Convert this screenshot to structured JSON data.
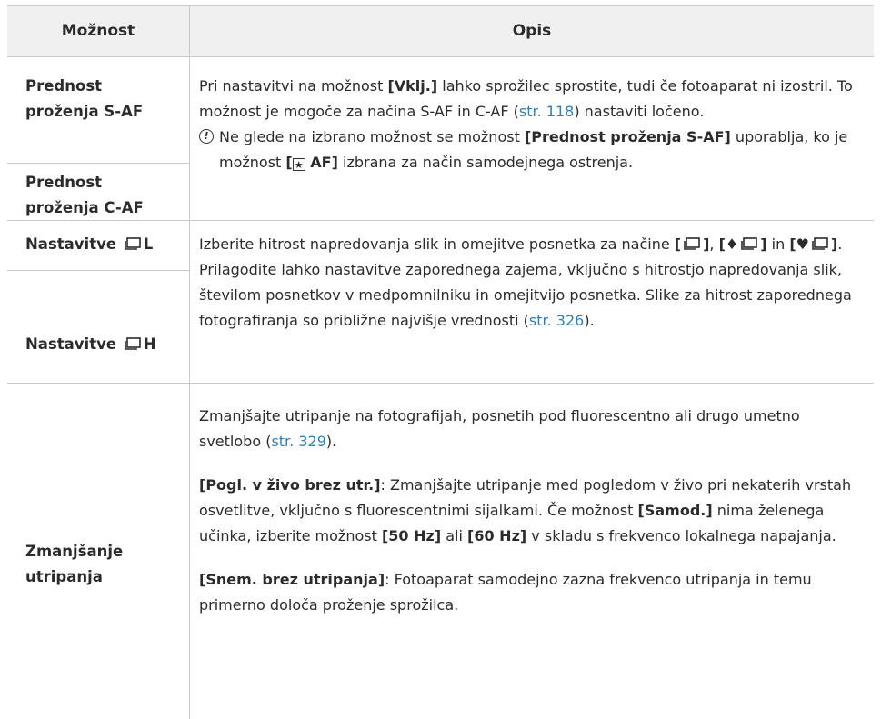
{
  "header": {
    "col_option": "Možnost",
    "col_desc": "Opis"
  },
  "rows": {
    "saf_label": "Prednost proženja S-AF",
    "caf_label": "Prednost proženja C-AF",
    "af_desc_1": "Pri nastavitvi na možnost",
    "af_desc_vklj": "[Vklj.]",
    "af_desc_2": "lahko sprožilec sprostite, tudi če fotoaparat ni izostril. To možnost je mogoče za načina S-AF in C-AF (",
    "af_link": "str. 118",
    "af_desc_3": ") nastaviti ločeno.",
    "note_1": "Ne glede na izbrano možnost se možnost",
    "note_b1": "[Prednost proženja S-AF]",
    "note_2": "uporablja, ko je možnost",
    "note_b2_pre": "[",
    "note_b2_post": " AF]",
    "note_3": "izbrana za način samodejnega ostrenja.",
    "seq_l_label": "Nastavitve",
    "seq_l_suffix": "L",
    "seq_h_label": "Nastavitve",
    "seq_h_suffix": "H",
    "seq_desc_1": "Izberite hitrost napredovanja slik in omejitve posnetka za načine",
    "seq_desc_2": "in",
    "seq_desc_3": ". Prilagodite lahko nastavitve zaporednega zajema, vključno s hitrostjo napredovanja slik, številom posnetkov v medpomnilniku in omejitvijo posnetka. Slike za hitrost zaporednega fotografiranja so približne najvišje vrednosti (",
    "seq_link": "str. 326",
    "seq_desc_4": ").",
    "flicker_label": "Zmanjšanje utripanja",
    "fl_p1_a": "Zmanjšajte utripanje na fotografijah, posnetih pod fluorescentno ali drugo umetno svetlobo (",
    "fl_link": "str. 329",
    "fl_p1_b": ").",
    "fl_p2_b": "[Pogl. v živo brez utr.]",
    "fl_p2_a": ": Zmanjšajte utripanje med pogledom v živo pri nekaterih vrstah osvetlitve, vključno s fluorescentnimi sijalkami. Če možnost",
    "fl_p2_samod": "[Samod.]",
    "fl_p2_c": "nima želenega učinka, izberite možnost",
    "fl_p2_50": "[50 Hz]",
    "fl_p2_d": "ali",
    "fl_p2_60": "[60 Hz]",
    "fl_p2_e": "v skladu s frekvenco lokalnega napajanja.",
    "fl_p3_b": "[Snem. brez utripanja]",
    "fl_p3_a": ": Fotoaparat samodejno zazna frekvenco utripanja in temu primerno določa proženje sprožilca."
  },
  "icons": {
    "note": "caution-icon",
    "sequential": "sequential-shooting-icon",
    "face": "face-priority-icon"
  }
}
